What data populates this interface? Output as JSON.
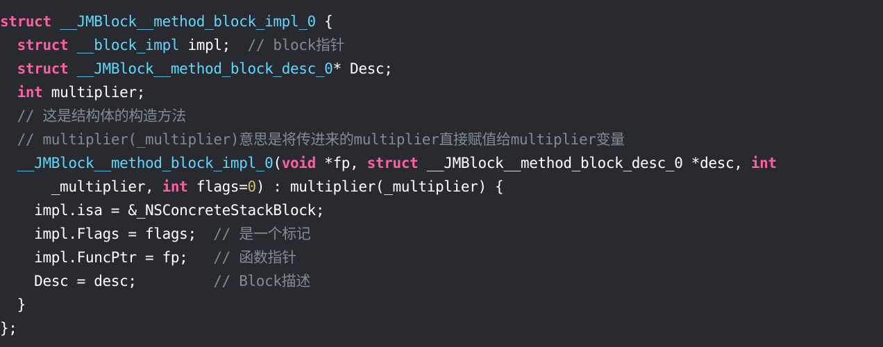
{
  "editor": {
    "background": "#292a30",
    "colors": {
      "keyword": "#fc5fa3",
      "type": "#5dd8ff",
      "comment": "#7f8c98",
      "number": "#d0bf69",
      "plain": "#ffffff"
    }
  },
  "code": {
    "lines": [
      [
        {
          "t": "kw",
          "v": "struct"
        },
        {
          "t": "pl",
          "v": " "
        },
        {
          "t": "ty",
          "v": "__JMBlock__method_block_impl_0"
        },
        {
          "t": "pl",
          "v": " {"
        }
      ],
      [
        {
          "t": "pl",
          "v": "  "
        },
        {
          "t": "kw",
          "v": "struct"
        },
        {
          "t": "pl",
          "v": " "
        },
        {
          "t": "ty",
          "v": "__block_impl"
        },
        {
          "t": "pl",
          "v": " impl;  "
        },
        {
          "t": "cm",
          "v": "// block指针"
        }
      ],
      [
        {
          "t": "pl",
          "v": "  "
        },
        {
          "t": "kw",
          "v": "struct"
        },
        {
          "t": "pl",
          "v": " "
        },
        {
          "t": "ty",
          "v": "__JMBlock__method_block_desc_0"
        },
        {
          "t": "pl",
          "v": "* Desc;"
        }
      ],
      [
        {
          "t": "pl",
          "v": "  "
        },
        {
          "t": "kw",
          "v": "int"
        },
        {
          "t": "pl",
          "v": " multiplier;"
        }
      ],
      [
        {
          "t": "pl",
          "v": "  "
        },
        {
          "t": "cm",
          "v": "// 这是结构体的构造方法"
        }
      ],
      [
        {
          "t": "pl",
          "v": "  "
        },
        {
          "t": "cm",
          "v": "// multiplier(_multiplier)意思是将传进来的multiplier直接赋值给multiplier变量"
        }
      ],
      [
        {
          "t": "pl",
          "v": "  "
        },
        {
          "t": "ty",
          "v": "__JMBlock__method_block_impl_0"
        },
        {
          "t": "pl",
          "v": "("
        },
        {
          "t": "kw",
          "v": "void"
        },
        {
          "t": "pl",
          "v": " *fp, "
        },
        {
          "t": "kw",
          "v": "struct"
        },
        {
          "t": "pl",
          "v": " __JMBlock__method_block_desc_0 *desc, "
        },
        {
          "t": "kw",
          "v": "int"
        }
      ],
      [
        {
          "t": "pl",
          "v": "      _multiplier, "
        },
        {
          "t": "kw",
          "v": "int"
        },
        {
          "t": "pl",
          "v": " flags="
        },
        {
          "t": "num",
          "v": "0"
        },
        {
          "t": "pl",
          "v": ") : multiplier(_multiplier) {"
        }
      ],
      [
        {
          "t": "pl",
          "v": "    impl.isa = &_NSConcreteStackBlock;"
        }
      ],
      [
        {
          "t": "pl",
          "v": "    impl.Flags = flags;  "
        },
        {
          "t": "cm",
          "v": "// 是一个标记"
        }
      ],
      [
        {
          "t": "pl",
          "v": "    impl.FuncPtr = fp;   "
        },
        {
          "t": "cm",
          "v": "// 函数指针"
        }
      ],
      [
        {
          "t": "pl",
          "v": "    Desc = desc;         "
        },
        {
          "t": "cm",
          "v": "// Block描述"
        }
      ],
      [
        {
          "t": "pl",
          "v": "  }"
        }
      ],
      [
        {
          "t": "pl",
          "v": "};"
        }
      ]
    ]
  }
}
